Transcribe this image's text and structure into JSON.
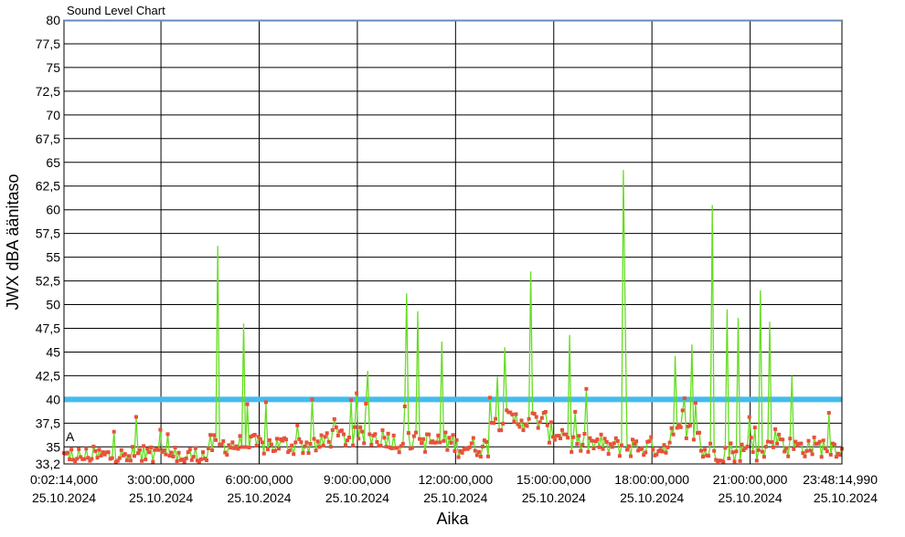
{
  "chart_data": {
    "type": "line",
    "title": "Sound Level Chart",
    "xlabel": "Aika",
    "ylabel": "JWX dBA äänitaso",
    "ylim": [
      33.2,
      80
    ],
    "y_ticks": [
      "33,2",
      "35",
      "37,5",
      "40",
      "42,5",
      "45",
      "47,5",
      "50",
      "52,5",
      "55",
      "57,5",
      "60",
      "62,5",
      "65",
      "67,5",
      "70",
      "72,5",
      "75",
      "77,5",
      "80"
    ],
    "x_ticks": [
      {
        "time": "0:02:14,000",
        "date": "25.10.2024"
      },
      {
        "time": "3:00:00,000",
        "date": "25.10.2024"
      },
      {
        "time": "6:00:00,000",
        "date": "25.10.2024"
      },
      {
        "time": "9:00:00,000",
        "date": "25.10.2024"
      },
      {
        "time": "12:00:00,000",
        "date": "25.10.2024"
      },
      {
        "time": "15:00:00,000",
        "date": "25.10.2024"
      },
      {
        "time": "18:00:00,000",
        "date": "25.10.2024"
      },
      {
        "time": "21:00:00,000",
        "date": "25.10.2024"
      },
      {
        "time": "23:48:14,990",
        "date": "25.10.2024"
      }
    ],
    "threshold": 40,
    "series_marker": "A",
    "colors": {
      "line": "#66dd22",
      "marker": "#e8503a",
      "threshold": "#44bbee",
      "grid": "#000000",
      "topline": "#6688bb"
    },
    "peaks": [
      {
        "hour": 4.75,
        "value": 56.2
      },
      {
        "hour": 5.55,
        "value": 48.0
      },
      {
        "hour": 10.5,
        "value": 51.2
      },
      {
        "hour": 10.85,
        "value": 49.3
      },
      {
        "hour": 11.6,
        "value": 46.1
      },
      {
        "hour": 14.3,
        "value": 53.5
      },
      {
        "hour": 17.1,
        "value": 64.2
      },
      {
        "hour": 17.2,
        "value": 49.0
      },
      {
        "hour": 19.85,
        "value": 60.5
      },
      {
        "hour": 20.3,
        "value": 49.5
      },
      {
        "hour": 20.65,
        "value": 48.6
      },
      {
        "hour": 21.3,
        "value": 51.5
      },
      {
        "hour": 21.6,
        "value": 48.2
      },
      {
        "hour": 9.3,
        "value": 43.0
      },
      {
        "hour": 13.5,
        "value": 45.5
      },
      {
        "hour": 15.5,
        "value": 46.8
      },
      {
        "hour": 18.7,
        "value": 44.6
      },
      {
        "hour": 19.2,
        "value": 45.8
      },
      {
        "hour": 22.3,
        "value": 42.5
      }
    ]
  }
}
